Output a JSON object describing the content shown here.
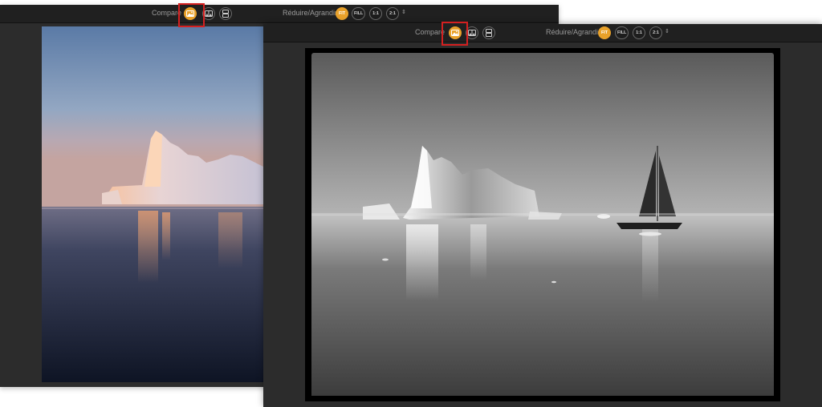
{
  "back_window": {
    "toolbar": {
      "compare_label": "Compare",
      "resize_label": "Réduire/Agrandir",
      "zoom_options": [
        "FIT",
        "FILL",
        "1:1",
        "2:1"
      ],
      "active_zoom": "FIT",
      "compare_modes": [
        "single-view-icon",
        "split-view-icon",
        "side-by-side-icon"
      ],
      "active_compare_mode": "single-view-icon"
    },
    "photo": {
      "kind": "color",
      "subject": "iceberg at sunset"
    }
  },
  "front_window": {
    "toolbar": {
      "compare_label": "Compare",
      "resize_label": "Réduire/Agrandir",
      "zoom_options": [
        "FIT",
        "FILL",
        "1:1",
        "2:1"
      ],
      "active_zoom": "FIT",
      "compare_modes": [
        "single-view-icon",
        "split-view-icon",
        "side-by-side-icon"
      ],
      "active_compare_mode": "single-view-icon"
    },
    "photo": {
      "kind": "black-and-white",
      "subject": "iceberg with sailboat",
      "frame": "film border"
    }
  },
  "colors": {
    "accent": "#e8a12a",
    "highlight_box": "#d42020",
    "toolbar_bg": "#202020",
    "window_bg": "#2c2c2c"
  }
}
